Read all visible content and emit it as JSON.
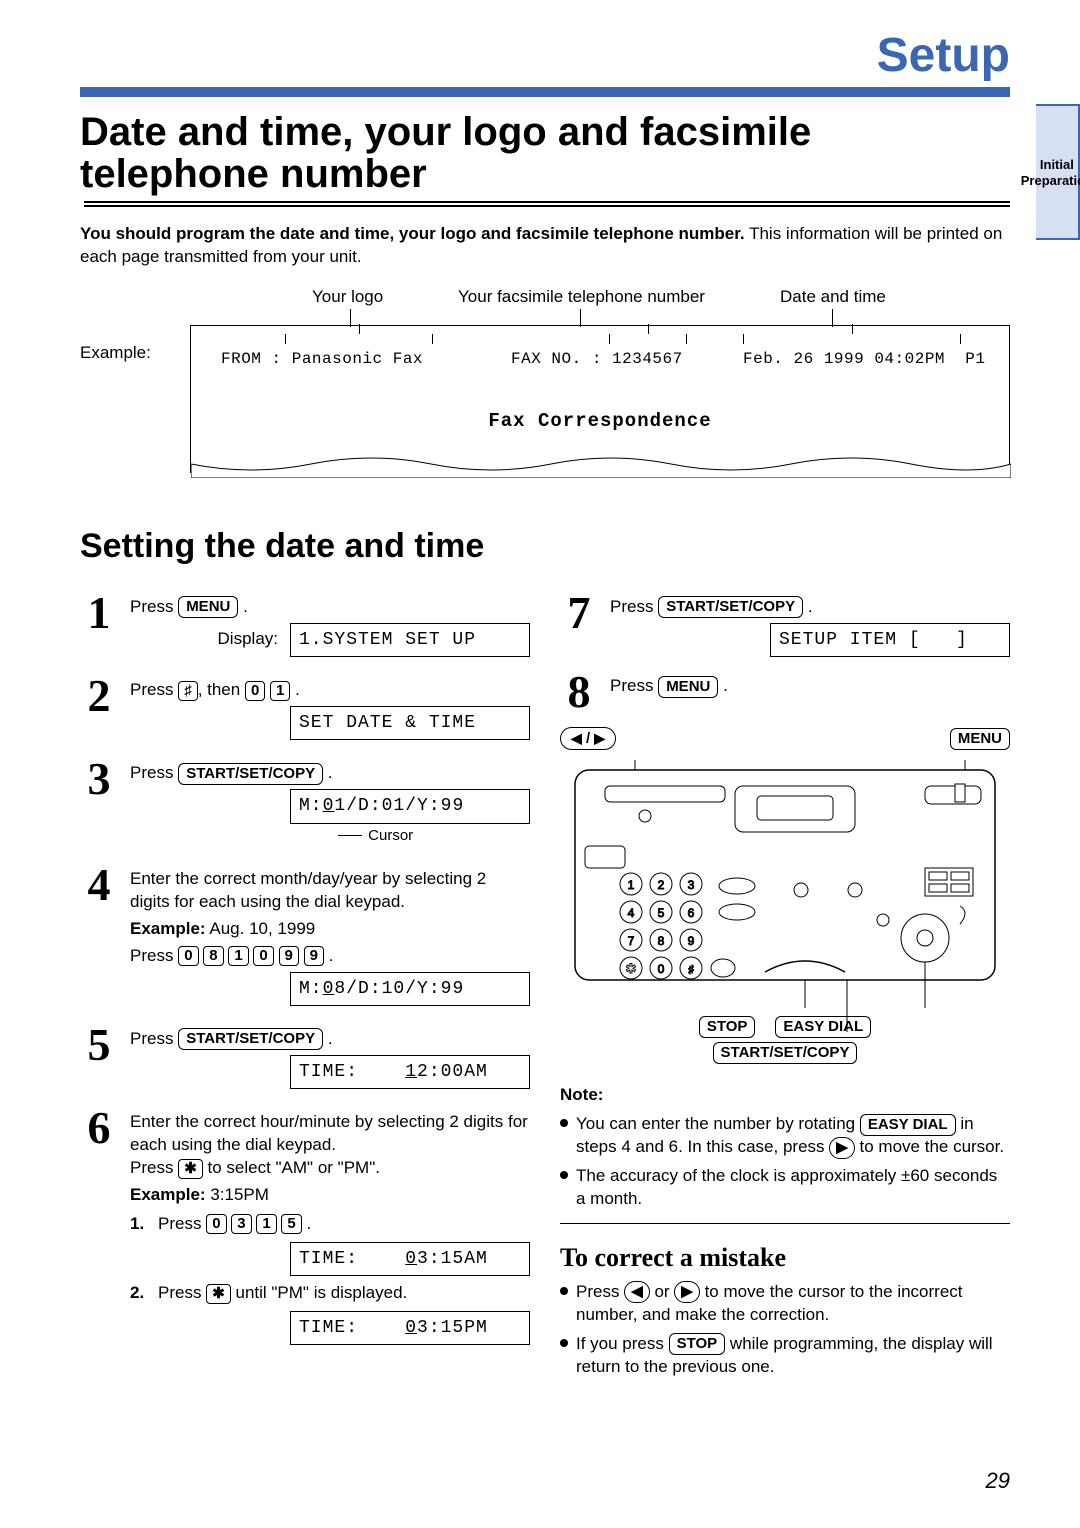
{
  "chapter": "Setup",
  "side_tab": "Initial\nPreparation",
  "h1": "Date and time, your logo and facsimile telephone number",
  "lead_bold": "You should program the date and time, your logo and facsimile telephone number.",
  "lead_rest": " This information will be printed on each page transmitted from your unit.",
  "example_label": "Example:",
  "top_labels": {
    "logo": "Your logo",
    "faxno": "Your facsimile telephone number",
    "datetime": "Date and time"
  },
  "fax_header": {
    "from": "FROM : Panasonic Fax",
    "faxno": "FAX NO. : 1234567",
    "date": "Feb. 26 1999 04:02PM  P1",
    "title": "Fax Correspondence"
  },
  "h2": "Setting the date and time",
  "steps_left": {
    "s1": {
      "text": "Press ",
      "key": "MENU",
      "display_label": "Display:",
      "lcd": "1.SYSTEM SET UP"
    },
    "s2": {
      "text1": "Press ",
      "key1": "♯",
      "text2": ", then ",
      "key2": "0",
      "key3": "1",
      "lcd": "SET DATE & TIME"
    },
    "s3": {
      "text": "Press ",
      "key": "START/SET/COPY",
      "lcd": "M:01/D:01/Y:99",
      "cursor": "Cursor"
    },
    "s4": {
      "p1": "Enter the correct month/day/year by selecting 2 digits for each using the dial keypad.",
      "ex_label": "Example:",
      "ex_val": " Aug. 10, 1999",
      "press": "Press ",
      "k": [
        "0",
        "8",
        "1",
        "0",
        "9",
        "9"
      ],
      "lcd": "M:08/D:10/Y:99"
    },
    "s5": {
      "text": "Press ",
      "key": "START/SET/COPY",
      "lcd": "TIME:    12:00AM"
    },
    "s6": {
      "p1": "Enter the correct hour/minute by selecting 2 digits for each using the dial keypad.",
      "p2a": "Press ",
      "p2key": "✱",
      "p2b": " to select \"AM\" or \"PM\".",
      "ex_label": "Example:",
      "ex_val": " 3:15PM",
      "li1_n": "1.",
      "li1_t": "Press ",
      "li1_k": [
        "0",
        "3",
        "1",
        "5"
      ],
      "lcd1": "TIME:    03:15AM",
      "li2_n": "2.",
      "li2_t1": "Press ",
      "li2_key": "✱",
      "li2_t2": " until \"PM\" is displayed.",
      "lcd2": "TIME:    03:15PM"
    }
  },
  "steps_right": {
    "s7": {
      "text": "Press ",
      "key": "START/SET/COPY",
      "lcd": "SETUP ITEM [   ]"
    },
    "s8": {
      "text": "Press ",
      "key": "MENU"
    }
  },
  "callouts": {
    "arrows": "◀ / ▶",
    "menu": "MENU",
    "stop": "STOP",
    "easy": "EASY DIAL",
    "ssc": "START/SET/COPY"
  },
  "note": {
    "h": "Note:",
    "b1a": "You can enter the number by rotating ",
    "b1key": "EASY DIAL",
    "b1b": " in steps 4 and 6. In this case, press ",
    "b1arrow": "▶",
    "b1c": " to move the cursor.",
    "b2": "The accuracy of the clock is approximately ±60 seconds a month."
  },
  "correct": {
    "h": "To correct a mistake",
    "b1a": "Press ",
    "b1l": "◀",
    "b1mid": " or ",
    "b1r": "▶",
    "b1b": " to move the cursor to the incorrect number, and make the correction.",
    "b2a": "If you press ",
    "b2key": "STOP",
    "b2b": " while programming, the display will return to the previous one."
  },
  "page_num": "29"
}
